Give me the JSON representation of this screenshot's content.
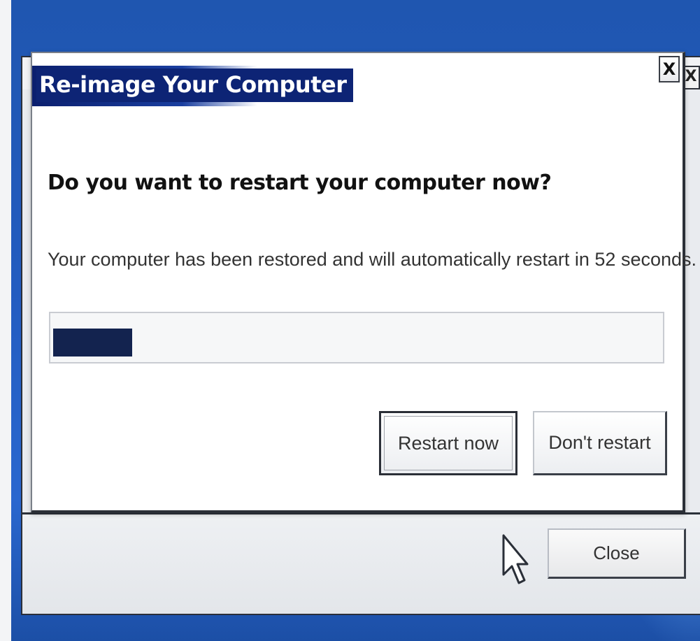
{
  "dialog": {
    "title": "Re-image Your Computer",
    "close_glyph": "X",
    "heading": "Do you want to restart your computer now?",
    "message": "Your computer has been restored and will automatically restart in 52 seconds.",
    "progress_fraction": 0.13,
    "buttons": {
      "restart_now": "Restart now",
      "dont_restart": "Don't restart"
    }
  },
  "background_window": {
    "close_glyph": "X",
    "close_button": "Close"
  },
  "colors": {
    "title_bar": "#0d2475",
    "progress_fill": "#13234f",
    "desktop": "#235cc0"
  },
  "icons": [
    "close-icon",
    "mouse-pointer-icon"
  ]
}
